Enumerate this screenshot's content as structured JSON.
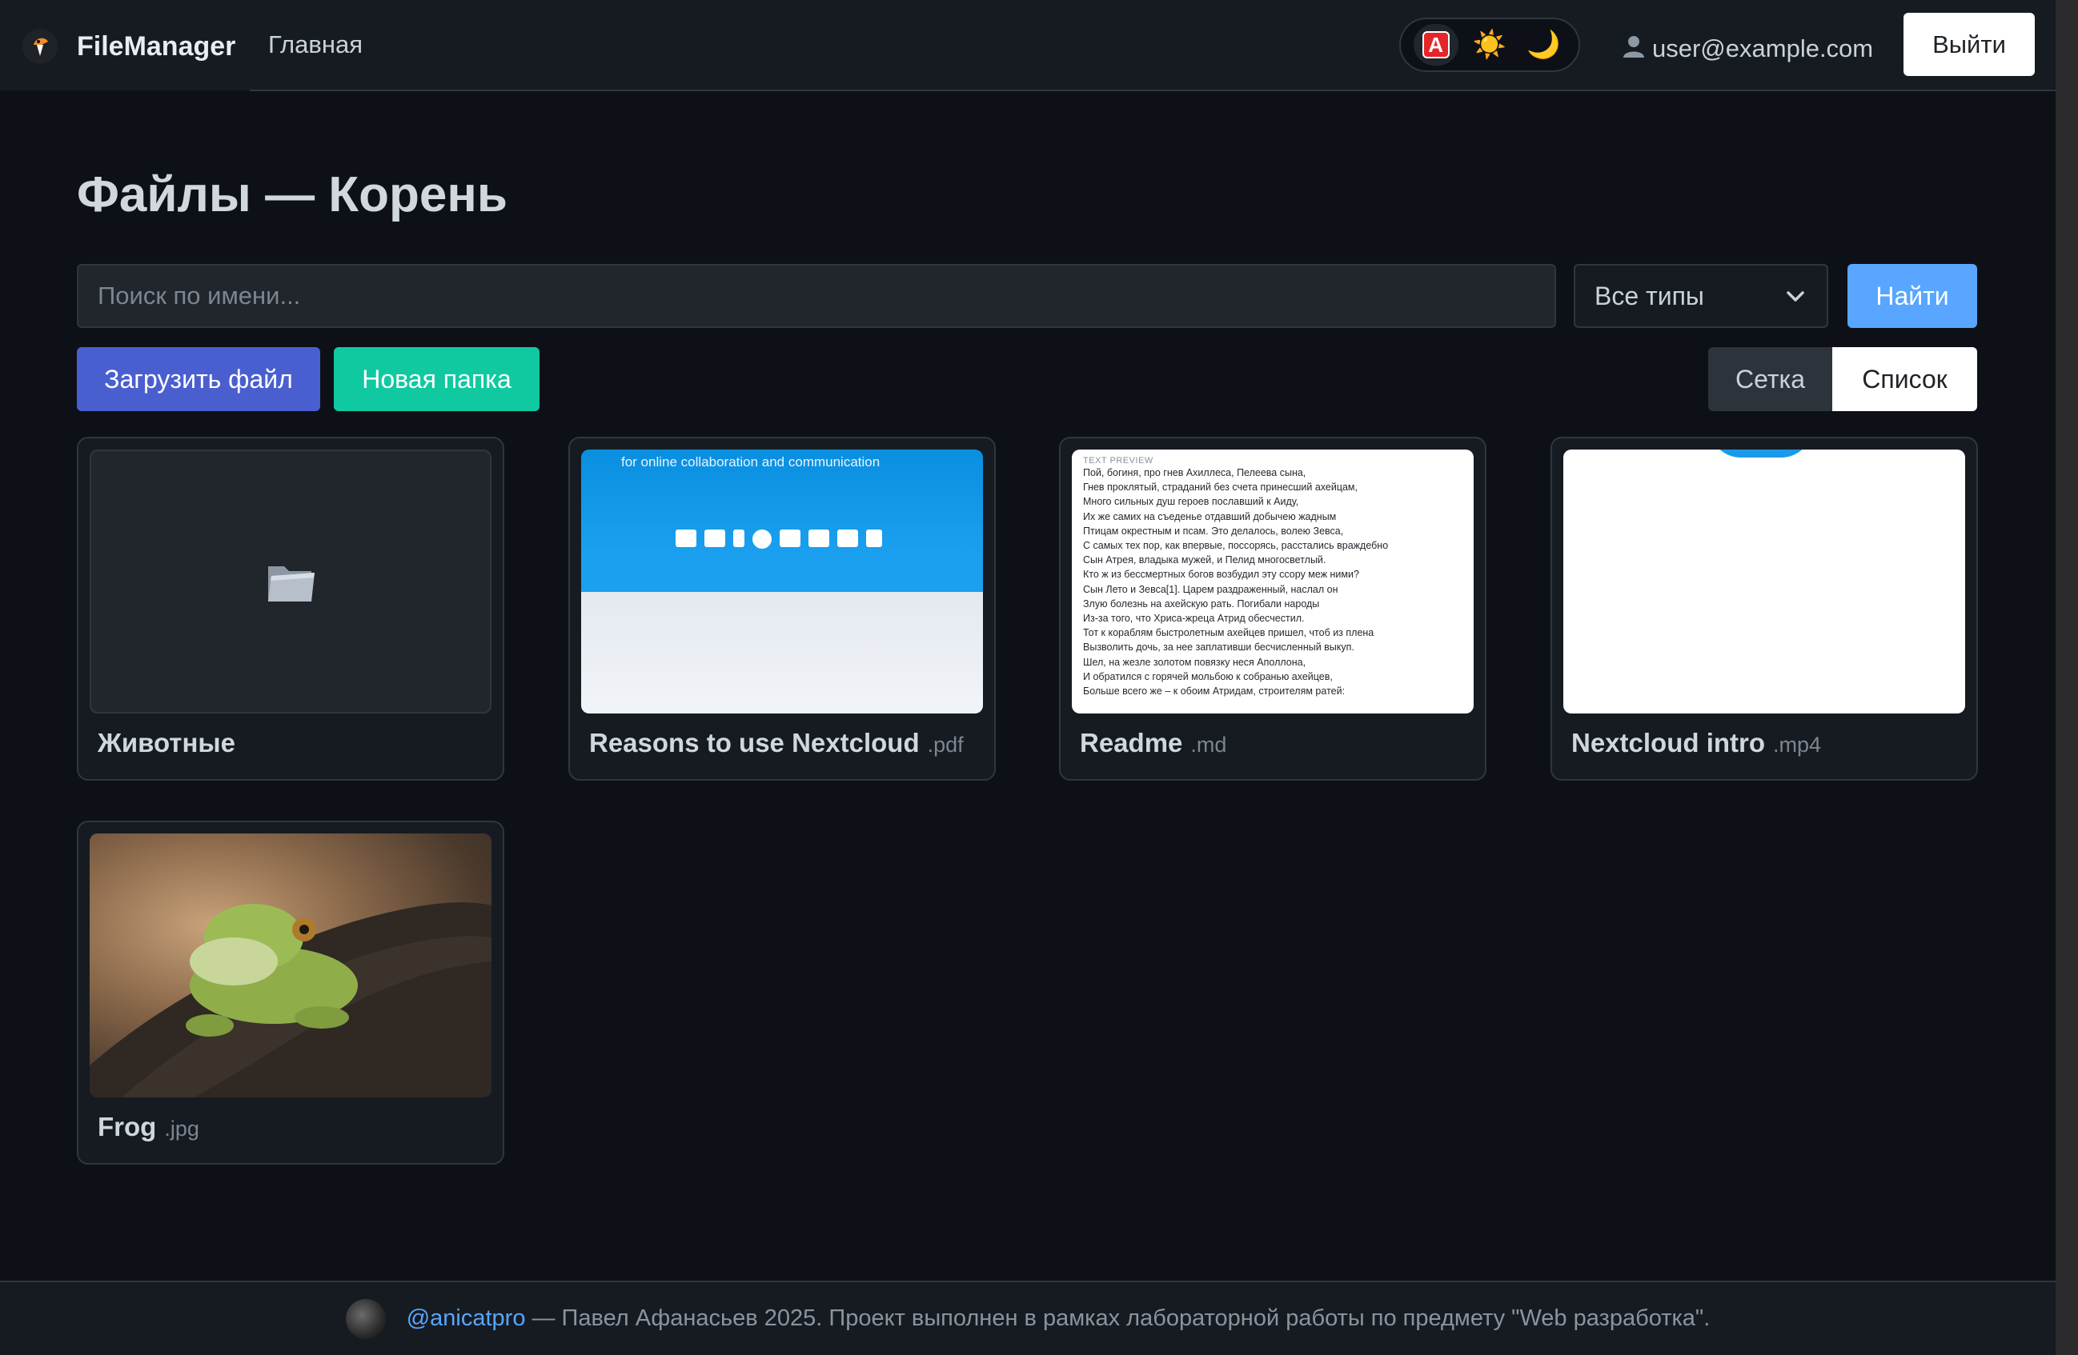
{
  "navbar": {
    "brand": "FileManager",
    "home_link": "Главная",
    "theme": {
      "auto_label": "A",
      "light_icon": "☀️",
      "dark_icon": "🌙",
      "active": "auto"
    },
    "user_email": "user@example.com",
    "logout_label": "Выйти"
  },
  "page": {
    "title": "Файлы — Корень"
  },
  "search": {
    "placeholder": "Поиск по имени...",
    "value": "",
    "type_filter": "Все типы",
    "submit_label": "Найти"
  },
  "actions": {
    "upload_label": "Загрузить файл",
    "new_folder_label": "Новая папка"
  },
  "view_toggle": {
    "grid_label": "Сетка",
    "list_label": "Список",
    "active": "list"
  },
  "files": [
    {
      "name": "Животные",
      "ext": "",
      "kind": "folder",
      "icon": "folder-icon"
    },
    {
      "name": "Reasons to use Nextcloud",
      "ext": ".pdf",
      "kind": "pdf",
      "preview_caption": "for online collaboration and communication"
    },
    {
      "name": "Readme",
      "ext": ".md",
      "kind": "text",
      "preview_label": "TEXT PREVIEW",
      "preview_lines": [
        "Пой, богиня, про гнев Ахиллеса, Пелеева сына,",
        "Гнев проклятый, страданий без счета принесший ахейцам,",
        "Много сильных душ героев пославший к Аиду,",
        "Их же самих на съеденье отдавший добычею жадным",
        "Птицам окрестным и псам. Это делалось, волею Зевса,",
        "С самых тех пор, как впервые, поссорясь, расстались враждебно",
        "Сын Атрея, владыка мужей, и Пелид многосветлый.",
        "Кто ж из бессмертных богов возбудил эту ссору меж ними?",
        "Сын Лето и Зевса[1]. Царем раздраженный, наслал он",
        "Злую болезнь на ахейскую рать. Погибали народы",
        "Из-за того, что Хриса-жреца Атрид обесчестил.",
        "Тот к кораблям быстролетным ахейцев пришел, чтоб из плена",
        "Вызволить дочь, за нее заплативши бесчисленный выкуп.",
        "Шел, на жезле золотом повязку неся Аполлона,",
        "И обратился с горячей мольбою к собранью ахейцев,",
        "Больше всего же – к обоим Атридам, строителям ратей:"
      ]
    },
    {
      "name": "Nextcloud intro",
      "ext": ".mp4",
      "kind": "video"
    },
    {
      "name": "Frog",
      "ext": ".jpg",
      "kind": "image"
    }
  ],
  "footer": {
    "handle": "@anicatpro",
    "text": "— Павел Афанасьев 2025. Проект выполнен в рамках лабораторной работы по предмету \"Web разработка\"."
  },
  "colors": {
    "background": "#0d1117",
    "navbar": "#161b22",
    "primary_blue": "#58a6ff",
    "upload_blue": "#4a5fcf",
    "new_folder_teal": "#11c9a1"
  }
}
